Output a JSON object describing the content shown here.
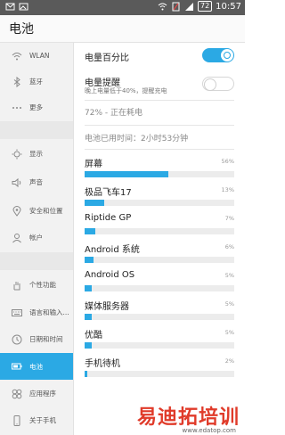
{
  "status": {
    "time": "10:57",
    "battery": "72"
  },
  "title": "电池",
  "sidebar": {
    "items": [
      {
        "label": "WLAN",
        "icon": "wifi-icon"
      },
      {
        "label": "蓝牙",
        "icon": "bluetooth-icon"
      },
      {
        "label": "更多",
        "icon": "more-icon"
      },
      {
        "label": "显示",
        "icon": "brightness-icon"
      },
      {
        "label": "声音",
        "icon": "volume-icon"
      },
      {
        "label": "安全和位置",
        "icon": "location-icon"
      },
      {
        "label": "帐户",
        "icon": "account-icon"
      },
      {
        "label": "个性功能",
        "icon": "hand-icon"
      },
      {
        "label": "语言和输入...",
        "icon": "keyboard-icon"
      },
      {
        "label": "日期和时间",
        "icon": "clock-icon"
      },
      {
        "label": "电池",
        "icon": "battery-icon"
      },
      {
        "label": "应用程序",
        "icon": "apps-icon"
      },
      {
        "label": "关于手机",
        "icon": "phone-icon"
      }
    ]
  },
  "main": {
    "percent_label": "电量百分比",
    "reminder_label": "电量提醒",
    "reminder_sub": "晚上电量低于40%，提醒充电",
    "status_text": "72% - 正在耗电",
    "usage_time": "电池已用时间：2小时53分钟",
    "usage": [
      {
        "name": "屏幕",
        "pct": "56%",
        "value": 56
      },
      {
        "name": "极品飞车17",
        "pct": "13%",
        "value": 13
      },
      {
        "name": "Riptide GP",
        "pct": "7%",
        "value": 7
      },
      {
        "name": "Android 系统",
        "pct": "6%",
        "value": 6
      },
      {
        "name": "Android OS",
        "pct": "5%",
        "value": 5
      },
      {
        "name": "媒体服务器",
        "pct": "5%",
        "value": 5
      },
      {
        "name": "优酷",
        "pct": "5%",
        "value": 5
      },
      {
        "name": "手机待机",
        "pct": "2%",
        "value": 2
      }
    ]
  },
  "watermark": {
    "text": "易迪拓培训",
    "url": "www.edatop.com"
  }
}
